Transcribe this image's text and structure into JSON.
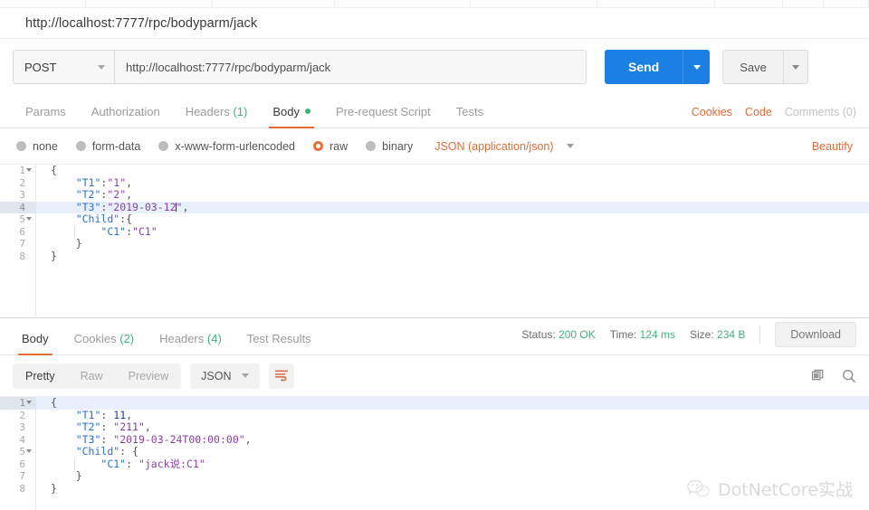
{
  "request_name": "http://localhost:7777/rpc/bodyparm/jack",
  "urlbar": {
    "method": "POST",
    "url": "http://localhost:7777/rpc/bodyparm/jack",
    "send_label": "Send",
    "save_label": "Save"
  },
  "request_tabs": [
    {
      "label": "Params",
      "count": "",
      "active": false,
      "dot": false
    },
    {
      "label": "Authorization",
      "count": "",
      "active": false,
      "dot": false
    },
    {
      "label": "Headers",
      "count": "(1)",
      "active": false,
      "dot": false
    },
    {
      "label": "Body",
      "count": "",
      "active": true,
      "dot": true
    },
    {
      "label": "Pre-request Script",
      "count": "",
      "active": false,
      "dot": false
    },
    {
      "label": "Tests",
      "count": "",
      "active": false,
      "dot": false
    }
  ],
  "request_tabs_right": {
    "cookies": "Cookies",
    "code": "Code",
    "comments": "Comments (0)"
  },
  "body_types": [
    {
      "label": "none",
      "selected": false
    },
    {
      "label": "form-data",
      "selected": false
    },
    {
      "label": "x-www-form-urlencoded",
      "selected": false
    },
    {
      "label": "raw",
      "selected": true
    },
    {
      "label": "binary",
      "selected": false
    }
  ],
  "body_format": "JSON (application/json)",
  "beautify_label": "Beautify",
  "request_body_lines": [
    {
      "n": "1",
      "fold": true,
      "highlight": false,
      "indent": 0,
      "tokens": [
        {
          "t": "p",
          "v": "{"
        }
      ]
    },
    {
      "n": "2",
      "fold": false,
      "highlight": false,
      "indent": 1,
      "tokens": [
        {
          "t": "k",
          "v": "\"T1\""
        },
        {
          "t": "p",
          "v": ":"
        },
        {
          "t": "s",
          "v": "\"1\""
        },
        {
          "t": "p",
          "v": ","
        }
      ]
    },
    {
      "n": "3",
      "fold": false,
      "highlight": false,
      "indent": 1,
      "tokens": [
        {
          "t": "k",
          "v": "\"T2\""
        },
        {
          "t": "p",
          "v": ":"
        },
        {
          "t": "s",
          "v": "\"2\""
        },
        {
          "t": "p",
          "v": ","
        }
      ]
    },
    {
      "n": "4",
      "fold": false,
      "highlight": true,
      "indent": 1,
      "tokens": [
        {
          "t": "k",
          "v": "\"T3\""
        },
        {
          "t": "p",
          "v": ":"
        },
        {
          "t": "s",
          "v": "\"2019-03-12"
        },
        {
          "t": "caret",
          "v": ""
        },
        {
          "t": "s",
          "v": "\""
        },
        {
          "t": "p",
          "v": ","
        }
      ]
    },
    {
      "n": "5",
      "fold": true,
      "highlight": false,
      "indent": 1,
      "tokens": [
        {
          "t": "k",
          "v": "\"Child\""
        },
        {
          "t": "p",
          "v": ":{"
        }
      ]
    },
    {
      "n": "6",
      "fold": false,
      "highlight": false,
      "indent": 2,
      "tokens": [
        {
          "t": "k",
          "v": "\"C1\""
        },
        {
          "t": "p",
          "v": ":"
        },
        {
          "t": "s",
          "v": "\"C1\""
        }
      ]
    },
    {
      "n": "7",
      "fold": false,
      "highlight": false,
      "indent": 1,
      "tokens": [
        {
          "t": "p",
          "v": "}"
        }
      ]
    },
    {
      "n": "8",
      "fold": false,
      "highlight": false,
      "indent": 0,
      "tokens": [
        {
          "t": "p",
          "v": "}"
        }
      ]
    }
  ],
  "response_tabs": [
    {
      "label": "Body",
      "count": "",
      "active": true
    },
    {
      "label": "Cookies",
      "count": "(2)",
      "active": false
    },
    {
      "label": "Headers",
      "count": "(4)",
      "active": false
    },
    {
      "label": "Test Results",
      "count": "",
      "active": false
    }
  ],
  "response_status": {
    "status_label": "Status:",
    "status_value": "200 OK",
    "time_label": "Time:",
    "time_value": "124 ms",
    "size_label": "Size:",
    "size_value": "234 B",
    "download_label": "Download"
  },
  "response_toolbar": {
    "views": [
      {
        "label": "Pretty",
        "active": true
      },
      {
        "label": "Raw",
        "active": false
      },
      {
        "label": "Preview",
        "active": false
      }
    ],
    "format": "JSON"
  },
  "response_body_lines": [
    {
      "n": "1",
      "fold": true,
      "highlight": true,
      "indent": 0,
      "tokens": [
        {
          "t": "p",
          "v": "{"
        }
      ]
    },
    {
      "n": "2",
      "fold": false,
      "highlight": false,
      "indent": 1,
      "tokens": [
        {
          "t": "k",
          "v": "\"T1\""
        },
        {
          "t": "p",
          "v": ": "
        },
        {
          "t": "n",
          "v": "11"
        },
        {
          "t": "p",
          "v": ","
        }
      ]
    },
    {
      "n": "3",
      "fold": false,
      "highlight": false,
      "indent": 1,
      "tokens": [
        {
          "t": "k",
          "v": "\"T2\""
        },
        {
          "t": "p",
          "v": ": "
        },
        {
          "t": "s",
          "v": "\"211\""
        },
        {
          "t": "p",
          "v": ","
        }
      ]
    },
    {
      "n": "4",
      "fold": false,
      "highlight": false,
      "indent": 1,
      "tokens": [
        {
          "t": "k",
          "v": "\"T3\""
        },
        {
          "t": "p",
          "v": ": "
        },
        {
          "t": "s",
          "v": "\"2019-03-24T00:00:00\""
        },
        {
          "t": "p",
          "v": ","
        }
      ]
    },
    {
      "n": "5",
      "fold": true,
      "highlight": false,
      "indent": 1,
      "tokens": [
        {
          "t": "k",
          "v": "\"Child\""
        },
        {
          "t": "p",
          "v": ": {"
        }
      ]
    },
    {
      "n": "6",
      "fold": false,
      "highlight": false,
      "indent": 2,
      "tokens": [
        {
          "t": "k",
          "v": "\"C1\""
        },
        {
          "t": "p",
          "v": ": "
        },
        {
          "t": "s",
          "v": "\"jack说:C1\""
        }
      ]
    },
    {
      "n": "7",
      "fold": false,
      "highlight": false,
      "indent": 1,
      "tokens": [
        {
          "t": "p",
          "v": "}"
        }
      ]
    },
    {
      "n": "8",
      "fold": false,
      "highlight": false,
      "indent": 0,
      "tokens": [
        {
          "t": "p",
          "v": "}"
        }
      ]
    }
  ],
  "watermark": "DotNetCore实战",
  "colors": {
    "accent_orange": "#e36b36",
    "send_blue": "#1b7fe3",
    "status_green": "#46b17d",
    "json_key": "#2f6fd0",
    "json_string": "#8a3fa8"
  }
}
